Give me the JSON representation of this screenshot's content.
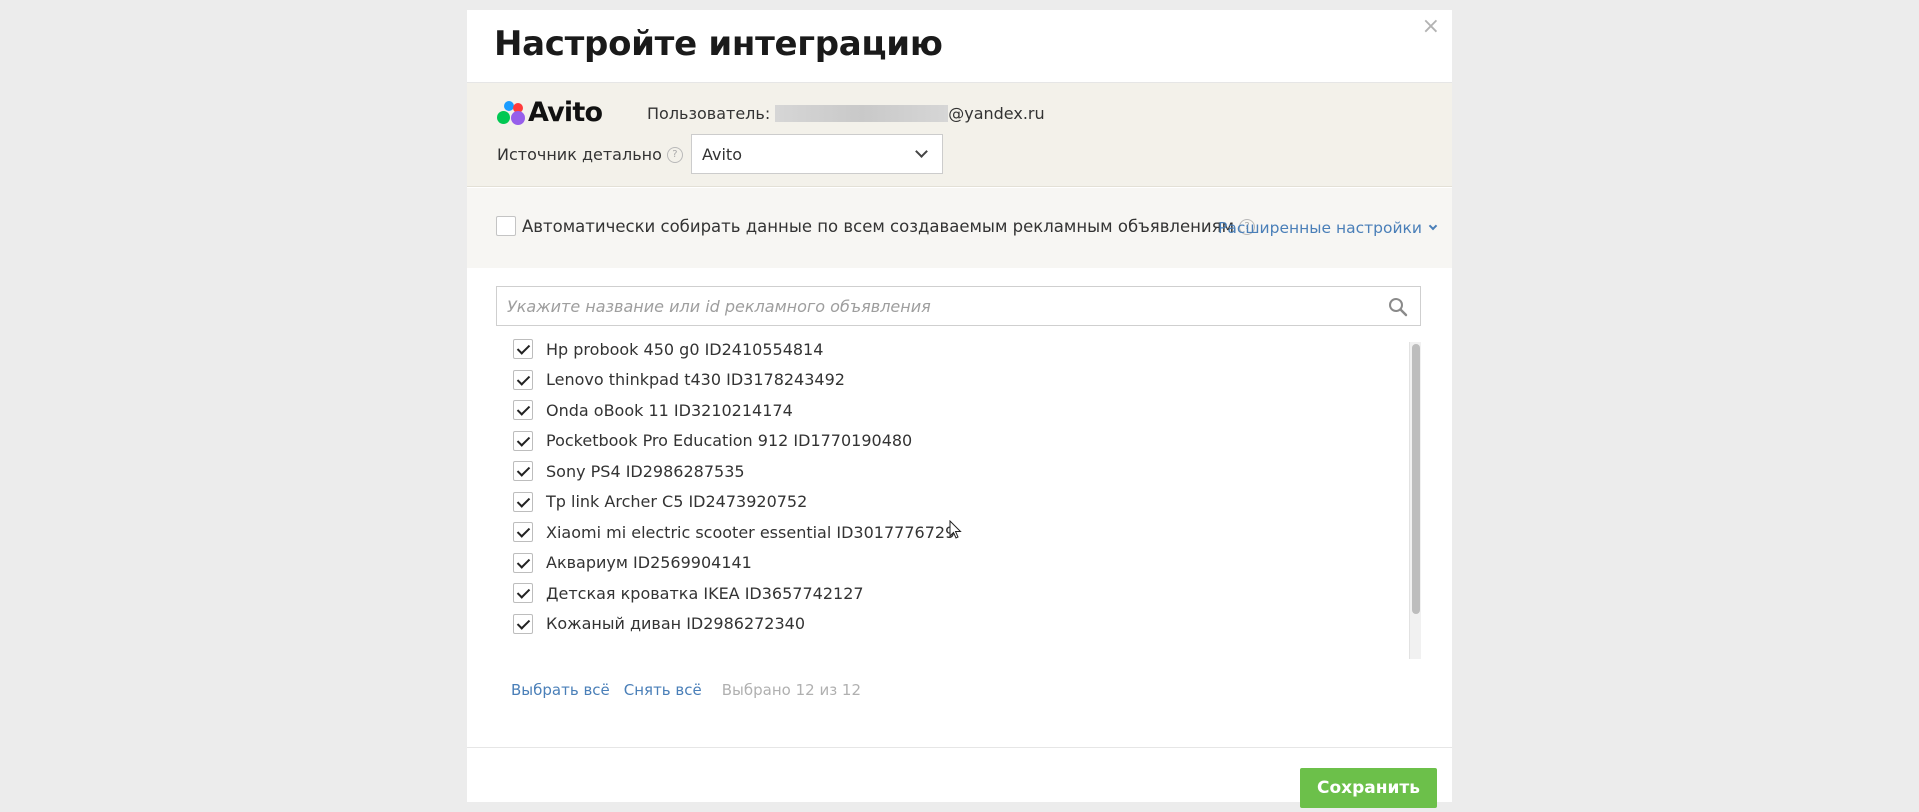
{
  "modal": {
    "title": "Настройте интеграцию",
    "close_icon": "×"
  },
  "integration": {
    "logo_text": "Avito",
    "user_label": "Пользователь:",
    "user_email_visible": "@yandex.ru",
    "source_label": "Источник детально",
    "source_help": "?",
    "source_value": "Avito"
  },
  "auto_collect": {
    "checked": false,
    "label": "Автоматически собирать данные по всем создаваемым рекламным объявлениям",
    "help": "?",
    "advanced_link": "Расширенные настройки"
  },
  "search": {
    "placeholder": "Укажите название или id рекламного объявления",
    "value": ""
  },
  "ads": [
    {
      "label": "Hp probook 450 g0 ID2410554814",
      "checked": true
    },
    {
      "label": "Lenovo thinkpad t430 ID3178243492",
      "checked": true
    },
    {
      "label": "Onda oBook 11 ID3210214174",
      "checked": true
    },
    {
      "label": "Pocketbook Pro Education 912 ID1770190480",
      "checked": true
    },
    {
      "label": "Sony PS4 ID2986287535",
      "checked": true
    },
    {
      "label": "Tp link Archer C5 ID2473920752",
      "checked": true
    },
    {
      "label": "Xiaomi mi electric scooter essential ID3017776729",
      "checked": true
    },
    {
      "label": "Аквариум ID2569904141",
      "checked": true
    },
    {
      "label": "Детская кроватка IKEA ID3657742127",
      "checked": true
    },
    {
      "label": "Кожаный диван ID2986272340",
      "checked": true
    }
  ],
  "footer": {
    "select_all": "Выбрать всё",
    "deselect_all": "Снять всё",
    "selected_count": "Выбрано 12 из 12"
  },
  "actions": {
    "save": "Сохранить"
  },
  "colors": {
    "save_green": "#6cc04a",
    "link_blue": "#4a7fb8",
    "panel_beige": "#f3f1ea"
  }
}
